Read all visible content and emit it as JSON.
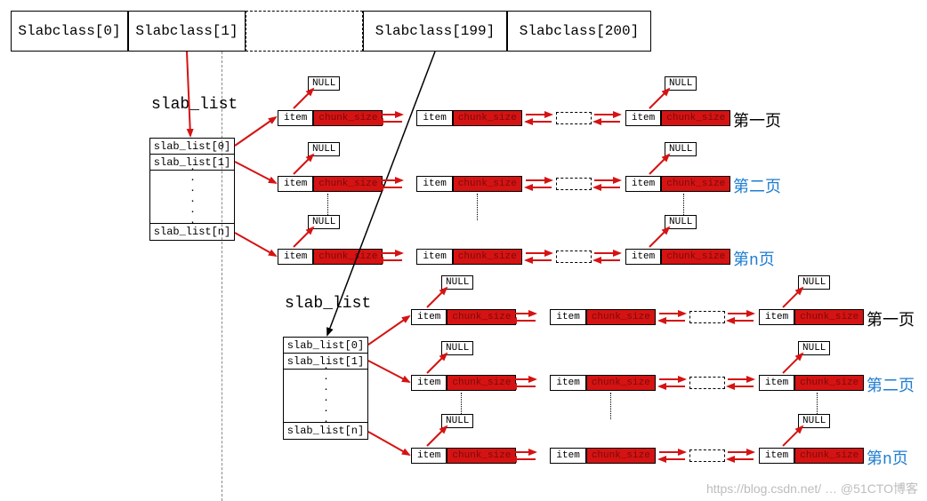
{
  "slabclass": {
    "cells": [
      "Slabclass[0]",
      "Slabclass[1]",
      "",
      "Slabclass[199]",
      "Slabclass[200]"
    ]
  },
  "slab_list_label": "slab_list",
  "slab_list_rows": [
    "slab_list[0]",
    "slab_list[1]",
    "slab_list[n]"
  ],
  "item_label": "item",
  "chunk_label": "chunk_size",
  "null_label": "NULL",
  "pages": {
    "p1": "第一页",
    "p2": "第二页",
    "pn": "第n页"
  },
  "watermark": "https://blog.csdn.net/ … @51CTO博客"
}
